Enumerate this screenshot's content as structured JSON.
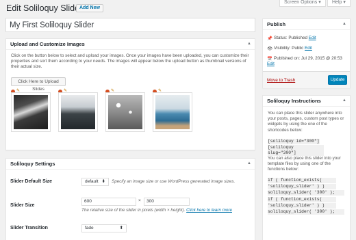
{
  "screen_options": "Screen Options",
  "help": "Help",
  "page_title": "Edit Soliloquy Slider",
  "add_new": "Add New",
  "post_title": "My First Soliloquy Slider",
  "upload_box": {
    "title": "Upload and Customize Images",
    "description": "Click on the button below to select and upload your images. Once your images have been uploaded, you can customize their properties and sort them according to your needs. The images will appear below the upload button as thumbnail versions of their actual size.",
    "button": "Click Here to Upload Slides"
  },
  "settings_box": {
    "title": "Soliloquy Settings",
    "default_size_label": "Slider Default Size",
    "default_size_value": "default",
    "default_size_help": "Specify an image size or use WordPress generated image sizes.",
    "slider_size_label": "Slider Size",
    "width_value": "600",
    "times": "×",
    "height_value": "300",
    "size_help_prefix": "The relative size of the slider in pixels (width × height).",
    "size_help_link": "Click here to learn more",
    "transition_label": "Slider Transition",
    "transition_value": "fade"
  },
  "publish_box": {
    "title": "Publish",
    "status_label": "Status: Published",
    "visibility_label": "Visibility: Public",
    "published_label": "Published on: Jul 29, 2015 @ 20:53",
    "edit": "Edit",
    "trash": "Move to Trash",
    "update": "Update"
  },
  "instructions_box": {
    "title": "Soliloquy Instructions",
    "text1": "You can place this slider anywhere into your posts, pages, custom post types or widgets by using the one of the shortcodes below:",
    "shortcode1": "[soliloquy id=\"300\"]",
    "shortcode2": "[soliloquy slug=\"300\"]",
    "text2": "You can also place this slider into your template files by using one of the functions below:",
    "code1a": "if ( function_exists(",
    "code1b": "'soliloquy_slider' ) )",
    "code1c": "soliloquy_slider( '300' );",
    "code2a": "if ( function_exists(",
    "code2b": "'soliloquy_slider' ) )",
    "code2c": "soliloquy_slider( '300' );"
  },
  "colors": {
    "primary": "#0085ba",
    "link": "#0073aa",
    "trash": "#a00",
    "delete_icon": "#d54e21"
  }
}
